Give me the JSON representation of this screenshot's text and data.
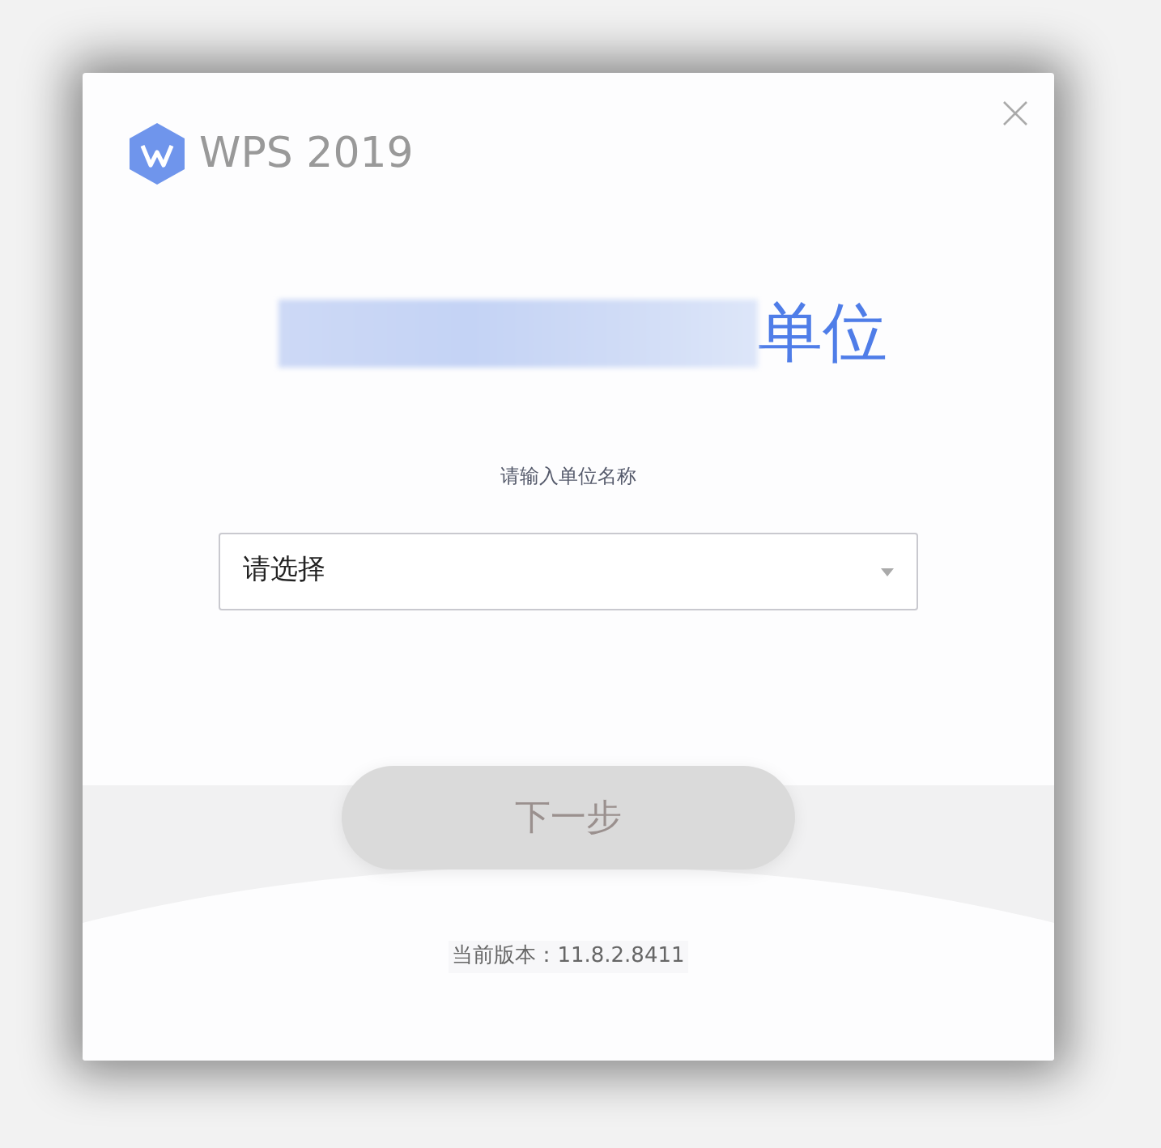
{
  "window": {
    "title": "WPS 2019"
  },
  "heading": {
    "redacted": true,
    "text": "单位"
  },
  "field_label": "请输入单位名称",
  "unit_select": {
    "value": "请选择"
  },
  "next_button": {
    "label": "下一步",
    "disabled": true
  },
  "version": "当前版本：11.8.2.8411"
}
